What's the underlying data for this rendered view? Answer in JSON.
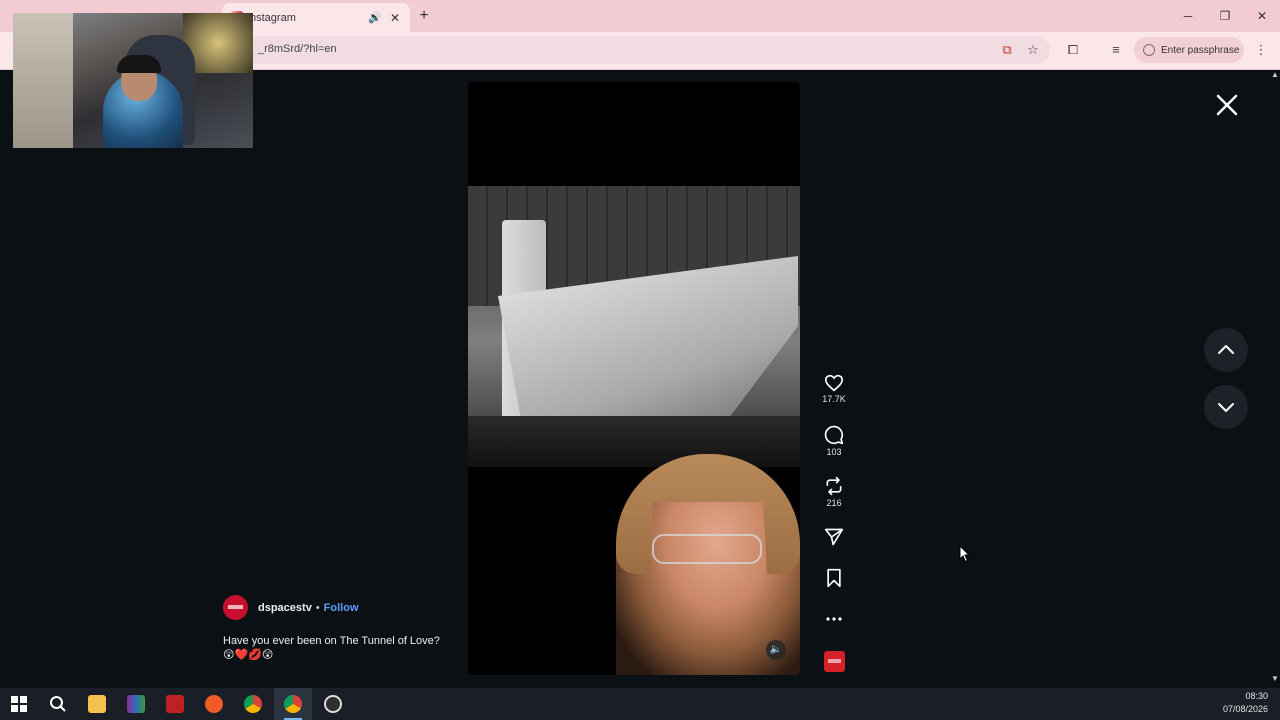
{
  "browser": {
    "tab_title": "nstagram",
    "new_tab": "+",
    "url": "_r8mSrd/?hl=en",
    "passphrase_label": "Enter passphrase",
    "window_controls": [
      "─",
      "❐",
      "✕"
    ]
  },
  "reel": {
    "author": "dspacestv",
    "separator": "•",
    "follow_label": "Follow",
    "caption_text": "Have you ever been on The Tunnel of Love?",
    "caption_emojis": "😲❤️💋😲",
    "likes": "17.7K",
    "comments": "103",
    "reposts": "216"
  },
  "taskbar": {
    "time": "08:30",
    "date": "07/08/2026",
    "icons": [
      "windows-start",
      "search",
      "file-explorer",
      "winrar",
      "filezilla",
      "brave",
      "chrome-badged",
      "chrome",
      "obs"
    ]
  },
  "colors": {
    "tab_bar": "#f3cbd3",
    "toolbar": "#fbe7ea",
    "page_bg": "#0b1014",
    "follow": "#5c9cf2",
    "brand_red": "#d6202a"
  }
}
